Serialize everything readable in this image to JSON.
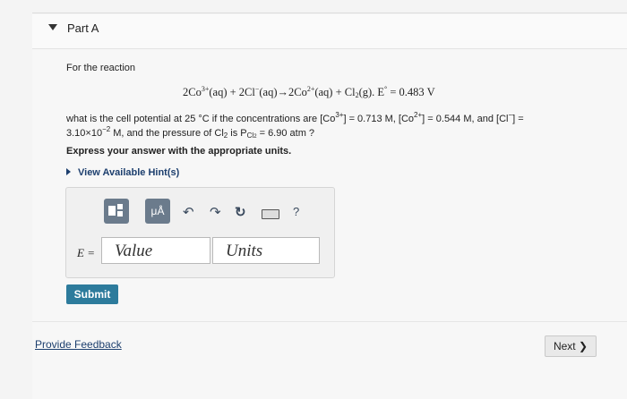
{
  "part": {
    "title": "Part A"
  },
  "question": {
    "intro": "For the reaction",
    "eq_left": "2Co",
    "eq_co3_charge": "3+",
    "eq_aq1": "(aq) + 2Cl",
    "eq_cl_charge": "−",
    "eq_aq2": "(aq)→2Co",
    "eq_co2_charge": "2+",
    "eq_aq3": "(aq) + Cl",
    "eq_cl2_sub": "2",
    "eq_g": "(g).  E",
    "eq_degree": "°",
    "eq_value": " = 0.483 V",
    "line1_a": "what is the cell potential at 25 °C if the concentrations are [Co",
    "line1_co3": "3+",
    "line1_b": "] = 0.713 M, [Co",
    "line1_co2": "2+",
    "line1_c": "] = 0.544 M, and [Cl",
    "line1_cl": "−",
    "line1_d": "] =",
    "line2_a": "3.10×10",
    "line2_exp": "−2",
    "line2_b": " M, and the pressure of Cl",
    "line2_sub": "2",
    "line2_c": " is P",
    "line2_psub": "Cl",
    "line2_psub2": "2",
    "line2_d": " = 6.90 atm ?",
    "instruction": "Express your answer with the appropriate units."
  },
  "hints": {
    "label": "View Available Hint(s)"
  },
  "toolbar": {
    "btn1_icon": "template-icon",
    "btn2_label": "μÅ",
    "undo_icon": "↶",
    "redo_icon": "↷",
    "reset_icon": "↻",
    "keyboard_icon": "keyboard-icon",
    "help_label": "?"
  },
  "answer": {
    "label": "E =",
    "value_placeholder": "Value",
    "units_placeholder": "Units"
  },
  "buttons": {
    "submit": "Submit",
    "feedback": "Provide Feedback",
    "next": "Next ❯"
  }
}
